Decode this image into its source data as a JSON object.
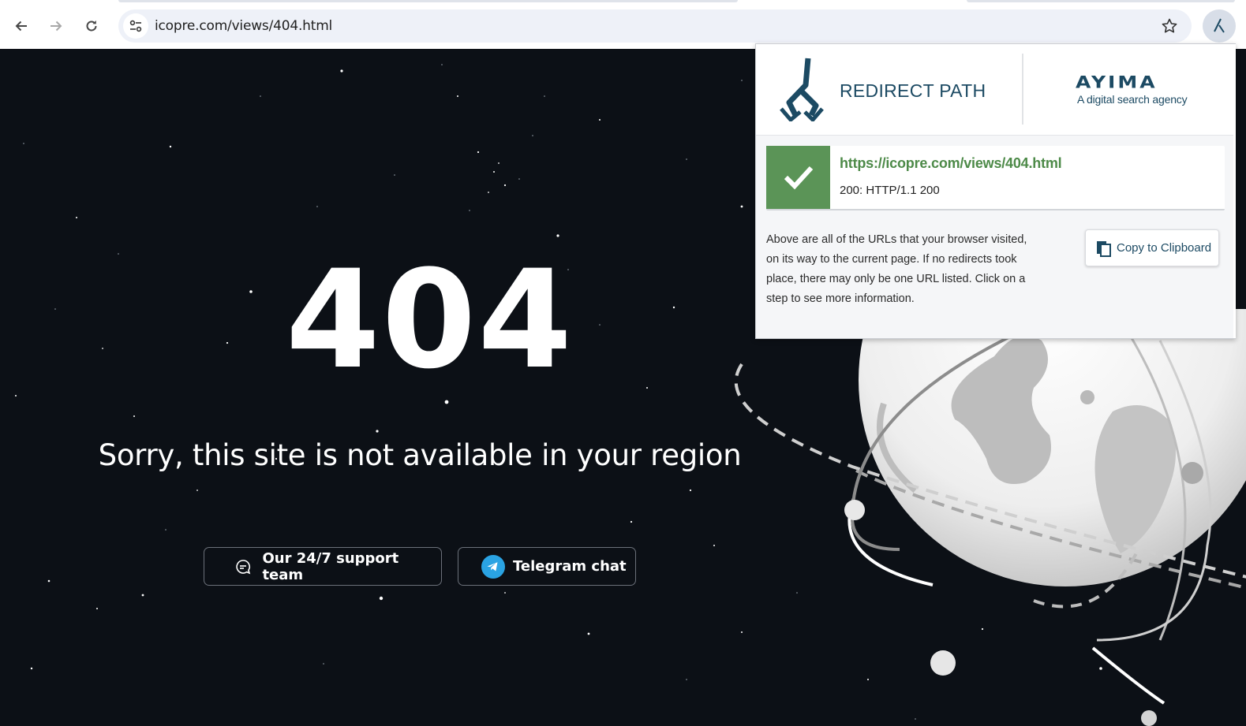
{
  "browser": {
    "url": "icopre.com/views/404.html",
    "icons": {
      "back": "arrow-left-icon",
      "forward": "arrow-right-icon",
      "reload": "reload-icon",
      "site_info": "tune-icon",
      "bookmark": "star-icon",
      "extension": "redirect-path-icon"
    }
  },
  "page": {
    "error_code": "404",
    "message": "Sorry, this site is not available in your region",
    "buttons": {
      "support_label": "Our 24/7 support team",
      "telegram_label": "Telegram chat"
    },
    "colors": {
      "background": "#0c1016",
      "telegram": "#2aa3e3"
    }
  },
  "popup": {
    "title": "REDIRECT PATH",
    "partner_name": "AYIMA",
    "partner_tagline": "A digital search agency",
    "result": {
      "url": "https://icopre.com/views/404.html",
      "status": "200: HTTP/1.1 200",
      "status_color": "#5b9457"
    },
    "info_text": "Above are all of the URLs that your browser visited, on its way to the current page. If no redirects took place, there may only be one URL listed. Click on a step to see more information.",
    "copy_label": "Copy to Clipboard",
    "colors": {
      "brand": "#1c4a63"
    }
  }
}
